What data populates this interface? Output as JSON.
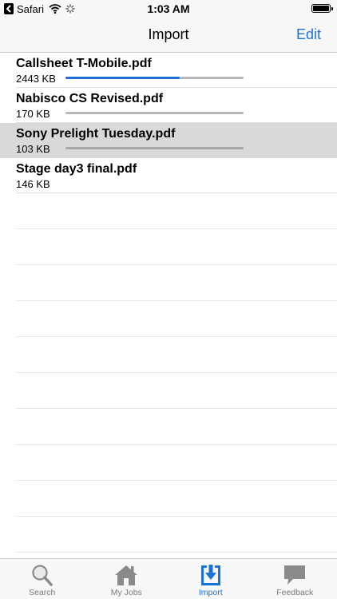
{
  "status_bar": {
    "back_app": "Safari",
    "time": "1:03 AM"
  },
  "nav": {
    "title": "Import",
    "edit_label": "Edit"
  },
  "files": [
    {
      "name": "Callsheet T-Mobile.pdf",
      "size": "2443 KB",
      "progress": 0.64,
      "selected": false
    },
    {
      "name": "Nabisco CS Revised.pdf",
      "size": "170 KB",
      "progress": 0,
      "selected": false
    },
    {
      "name": "Sony Prelight Tuesday.pdf",
      "size": "103 KB",
      "progress": 0,
      "selected": true
    },
    {
      "name": "Stage day3 final.pdf",
      "size": "146 KB",
      "progress": null,
      "selected": false
    }
  ],
  "tabs": [
    {
      "label": "Search",
      "icon": "magnifier-icon",
      "active": false
    },
    {
      "label": "My Jobs",
      "icon": "house-icon",
      "active": false
    },
    {
      "label": "Import",
      "icon": "import-icon",
      "active": true
    },
    {
      "label": "Feedback",
      "icon": "speech-bubble-icon",
      "active": false
    }
  ],
  "colors": {
    "accent": "#1a73d9",
    "selected_row": "#d9d9d9",
    "tab_inactive": "#7a7a7a"
  }
}
